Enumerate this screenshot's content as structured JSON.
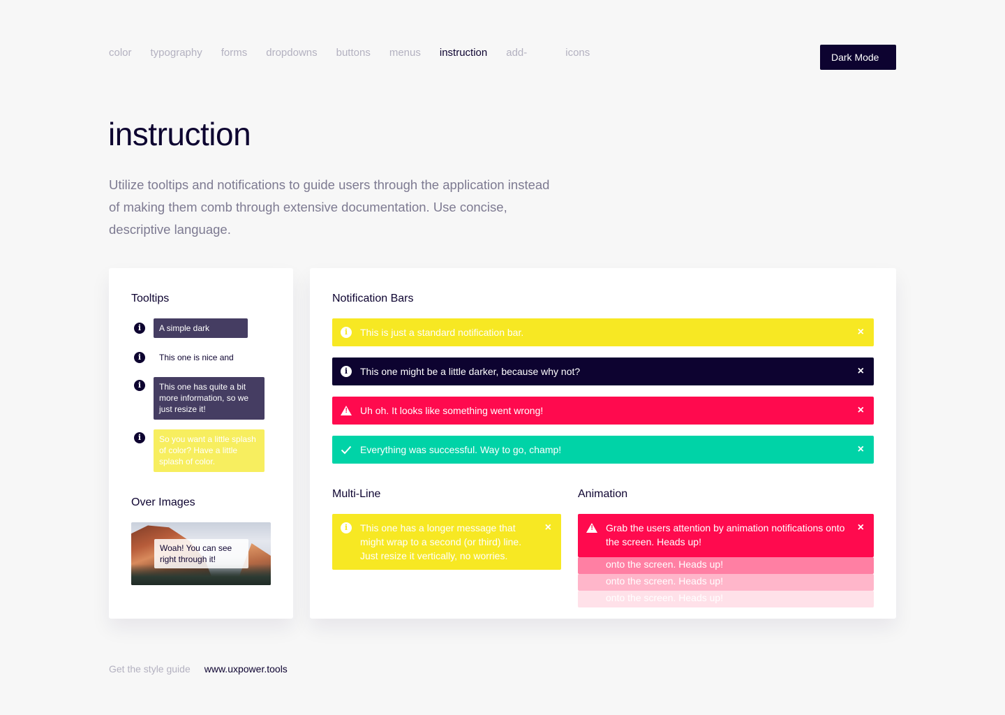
{
  "nav": {
    "items": [
      "color",
      "typography",
      "forms",
      "dropdowns",
      "buttons",
      "menus",
      "instruction",
      "add-",
      "icons"
    ],
    "active": "instruction"
  },
  "dark_mode_label": "Dark Mode",
  "page": {
    "title": "instruction",
    "intro": "Utilize tooltips and notifications to guide users through the application instead of making them comb through extensive documentation. Use concise, descriptive language."
  },
  "tooltips": {
    "title": "Tooltips",
    "items": [
      "A simple dark",
      "This one is nice and",
      "This one has quite a bit more information, so we just resize it!",
      "So you want a little splash of color? Have a little splash of color."
    ],
    "over_images_title": "Over Images",
    "over_image_text": "Woah! You can see right through it!"
  },
  "notifications": {
    "title": "Notification Bars",
    "bars": [
      {
        "text": "This is just a standard notification bar.",
        "color": "#f7e823",
        "icon": "info-icon"
      },
      {
        "text": "This one might be a little darker, because why not?",
        "color": "#0d0330",
        "icon": "info-icon"
      },
      {
        "text": "Uh oh. It looks like something went wrong!",
        "color": "#ff0a4e",
        "icon": "warning-icon"
      },
      {
        "text": "Everything was successful. Way to go, champ!",
        "color": "#00d3a7",
        "icon": "check-icon"
      }
    ],
    "close_glyph": "×",
    "multiline_title": "Multi-Line",
    "multiline_text": "This one has a longer message that might wrap to a second (or third) line. Just resize it vertically, no worries.",
    "animation_title": "Animation",
    "animation_text": "Grab the users attention by animation notifications onto the screen. Heads up!",
    "animation_ghost_1": "onto the screen. Heads up!",
    "animation_ghost_2": "onto the screen. Heads up!",
    "animation_ghost_3": "onto the screen. Heads up!"
  },
  "footer": {
    "label": "Get the style guide",
    "link": "www.uxpower.tools"
  }
}
